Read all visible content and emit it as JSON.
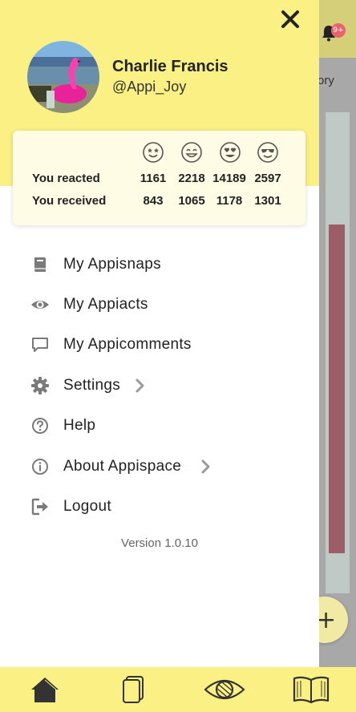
{
  "background": {
    "history_fragment": "ory",
    "badge": "9+"
  },
  "profile": {
    "name": "Charlie Francis",
    "handle": "@Appi_Joy"
  },
  "stats": {
    "reactions": [
      "star-eyes-emoji",
      "grin-emoji",
      "heart-eyes-emoji",
      "sunglasses-emoji"
    ],
    "reacted_label": "You reacted",
    "received_label": "You received",
    "reacted": [
      "1161",
      "2218",
      "14189",
      "2597"
    ],
    "received": [
      "843",
      "1065",
      "1178",
      "1301"
    ]
  },
  "menu": {
    "items": [
      {
        "label": "My Appisnaps",
        "icon": "book-icon"
      },
      {
        "label": "My Appiacts",
        "icon": "eye-icon"
      },
      {
        "label": "My Appicomments",
        "icon": "comment-icon"
      },
      {
        "label": "Settings",
        "icon": "gear-icon"
      },
      {
        "label": "Help",
        "icon": "question-icon"
      },
      {
        "label": "About Appispace",
        "icon": "info-icon"
      },
      {
        "label": "Logout",
        "icon": "logout-icon"
      }
    ]
  },
  "version": "Version 1.0.10",
  "bottom_nav": {
    "items": [
      "home-icon",
      "cards-icon",
      "eye-icon",
      "open-book-icon"
    ]
  },
  "colors": {
    "accent_yellow": "#faf083",
    "stats_bg": "#fffce6",
    "text": "#222222",
    "icon_gray": "#7a7a7a"
  }
}
